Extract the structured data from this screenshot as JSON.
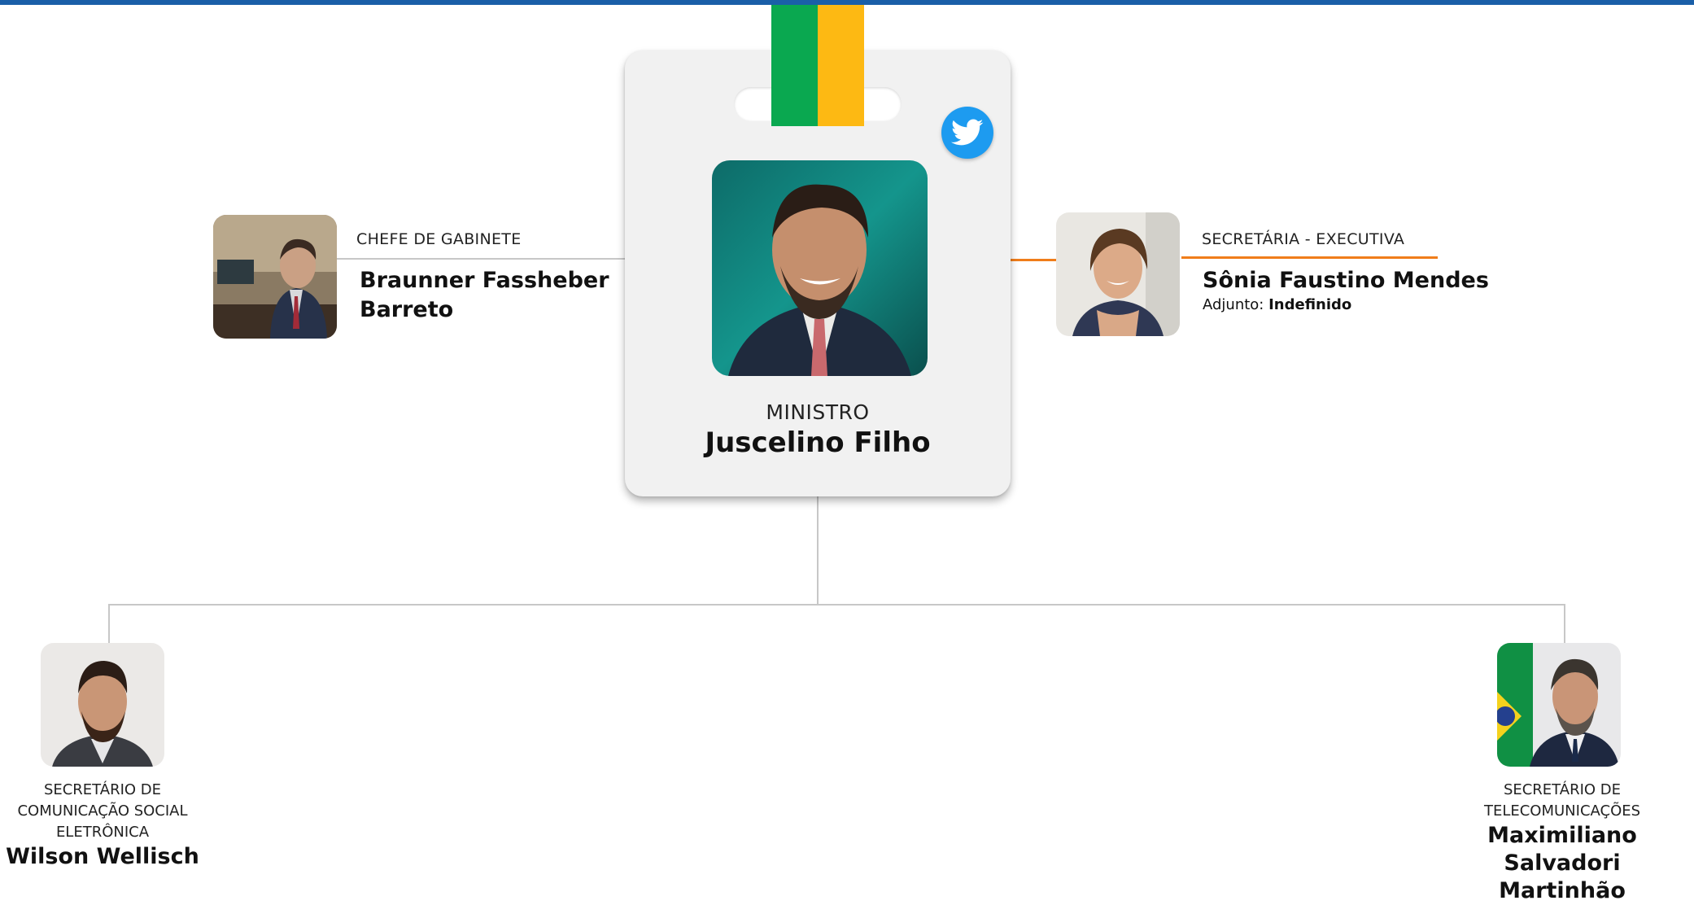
{
  "colors": {
    "top_bar": "#1a5fa8",
    "lanyard_green": "#0aa850",
    "lanyard_yellow": "#fdb913",
    "accent_line": "#f07d1a",
    "twitter": "#1d9bf0"
  },
  "minister": {
    "role": "MINISTRO",
    "name": "Juscelino Filho",
    "social_icon": "twitter-icon"
  },
  "chief_of_staff": {
    "role": "CHEFE DE GABINETE",
    "name_line1": "Braunner Fassheber",
    "name_line2": "Barreto"
  },
  "executive_secretary": {
    "role": "SECRETÁRIA - EXECUTIVA",
    "name": "Sônia Faustino Mendes",
    "deputy_label": "Adjunto:",
    "deputy_value": "Indefinido"
  },
  "secretary_comms": {
    "role_line1": "SECRETÁRIO DE",
    "role_line2": "COMUNICAÇÃO SOCIAL",
    "role_line3": "ELETRÔNICA",
    "name": "Wilson Wellisch"
  },
  "secretary_telecom": {
    "role_line1": "SECRETÁRIO DE",
    "role_line2": "TELECOMUNICAÇÕES",
    "name_line1": "Maximiliano",
    "name_line2": "Salvadori Martinhão"
  }
}
